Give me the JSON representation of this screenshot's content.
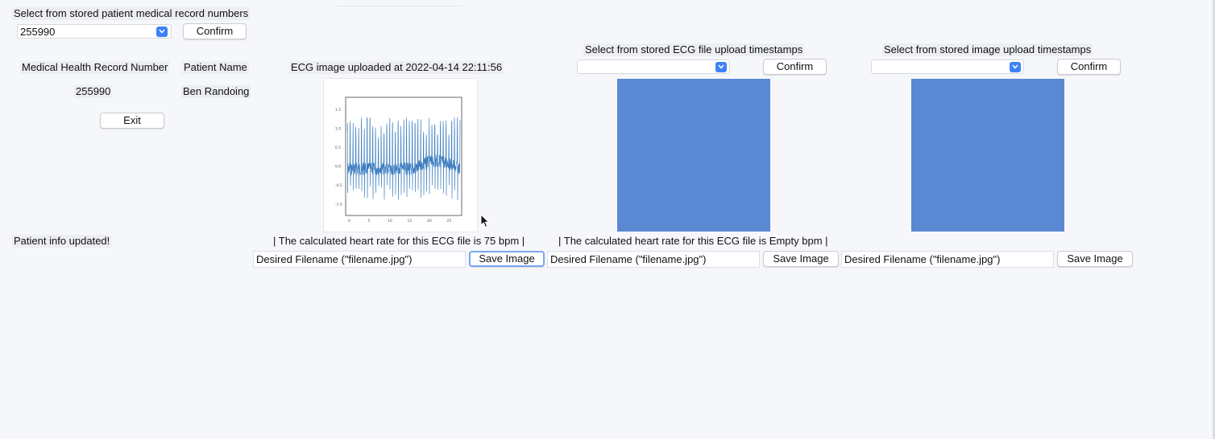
{
  "patient_select": {
    "label": "Select from stored patient medical record numbers",
    "value": "255990",
    "confirm_label": "Confirm"
  },
  "info": {
    "mrn_header": "Medical Health Record Number",
    "name_header": "Patient Name",
    "mrn_value": "255990",
    "name_value": "Ben Randoing",
    "exit_label": "Exit",
    "status": "Patient info updated!"
  },
  "panel1": {
    "title": "ECG image uploaded at 2022-04-14 22:11:56",
    "heart_rate": "| The calculated heart rate for this ECG file is 75 bpm |",
    "filename": "Desired Filename (\"filename.jpg\")",
    "save_label": "Save Image",
    "plot_y_ticks": [
      "1.5",
      "1.0",
      "0.5",
      "0.0",
      "-0.5",
      "-1.0"
    ],
    "plot_x_ticks": [
      "0",
      "5",
      "10",
      "15",
      "20",
      "25"
    ]
  },
  "panel2": {
    "select_label": "Select from stored ECG file upload timestamps",
    "select_value": "",
    "confirm_label": "Confirm",
    "heart_rate": "| The calculated heart rate for this ECG file is Empty bpm |",
    "filename": "Desired Filename (\"filename.jpg\")",
    "save_label": "Save Image"
  },
  "panel3": {
    "select_label": "Select from stored image upload timestamps",
    "select_value": "",
    "confirm_label": "Confirm",
    "filename": "Desired Filename (\"filename.jpg\")",
    "save_label": "Save Image"
  },
  "colors": {
    "placeholder_fill": "#5b88d2",
    "combo_arrow": "#3d82f5",
    "ecg_trace": "#3f7fc0"
  }
}
